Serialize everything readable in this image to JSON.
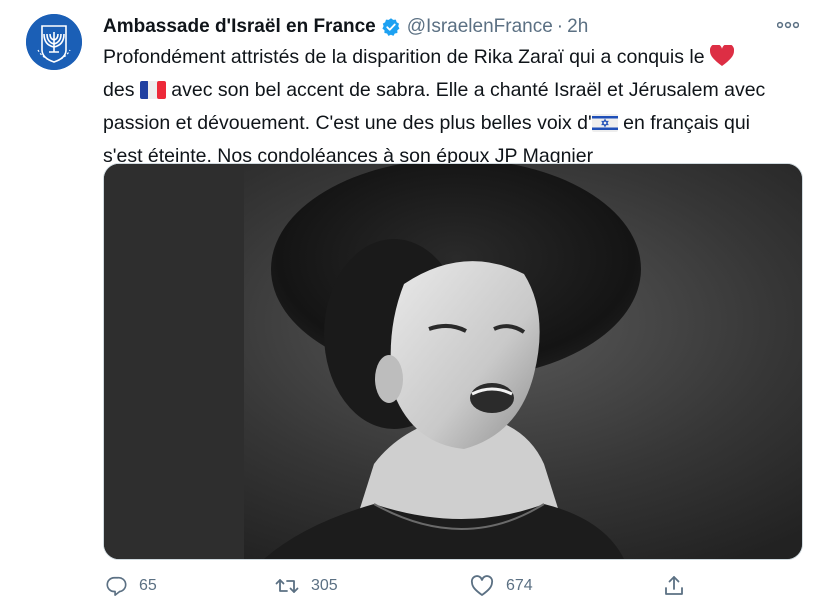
{
  "colors": {
    "text": "#0f1419",
    "secondary": "#5b7083",
    "verified": "#1da1f2",
    "avatar_bg": "#1b5fb6",
    "heart": "#e0245e"
  },
  "tweet": {
    "author": {
      "display_name": "Ambassade d'Israël en France",
      "handle": "@IsraelenFrance",
      "separator": "·",
      "time": "2h",
      "verified_icon": "verified-badge-icon",
      "avatar_icon": "menorah-emblem-icon"
    },
    "text": {
      "line1": "Profondément attristés de la disparition de Rika Zaraï qui a conquis le",
      "line2_a": "des",
      "line2_b": "avec son bel accent de sabra. Elle a chanté Israël et Jérusalem avec",
      "line3": "passion et dévouement. C'est une des plus belles voix d'",
      "line3_b": "en français qui",
      "line4": "s'est éteinte. Nos condoléances à son époux JP Magnier"
    },
    "emojis": {
      "heart": "red-heart-emoji",
      "france": "france-flag-emoji",
      "israel": "israel-flag-emoji"
    },
    "media": {
      "description": "black-and-white-photo",
      "icon": "photo-singer-image"
    },
    "actions": {
      "reply_count": "65",
      "retweet_count": "305",
      "like_count": "674"
    }
  }
}
